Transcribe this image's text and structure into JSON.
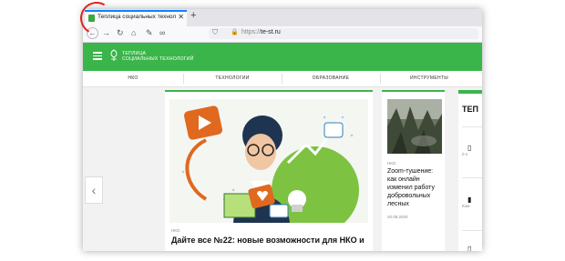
{
  "browser": {
    "tab_title": "Теплица социальных техноло",
    "tab_close": "✕",
    "new_tab": "+",
    "url_protocol": "https://",
    "url_host": "te-st.ru"
  },
  "site": {
    "logo_line1": "ТЕПЛИЦА",
    "logo_line2": "СОЦИАЛЬНЫХ ТЕХНОЛОГИЙ",
    "menu": [
      "НКО",
      "ТЕХНОЛОГИИ",
      "ОБРАЗОВАНИЕ",
      "ИНСТРУМЕНТЫ"
    ],
    "brand_color": "#3ab54a"
  },
  "carousel": {
    "prev_arrow": "‹"
  },
  "main_article": {
    "tag": "НКО",
    "title": "Дайте все №22: новые возможности для НКО и"
  },
  "side_article": {
    "tag": "НКО",
    "title": "Zoom-тушение: как онлайн изменил работу добровольных лесных",
    "date": "20.08.2020"
  },
  "right_panel": {
    "title": "ТЕП",
    "item1": "0 п",
    "item2": "Ком"
  }
}
